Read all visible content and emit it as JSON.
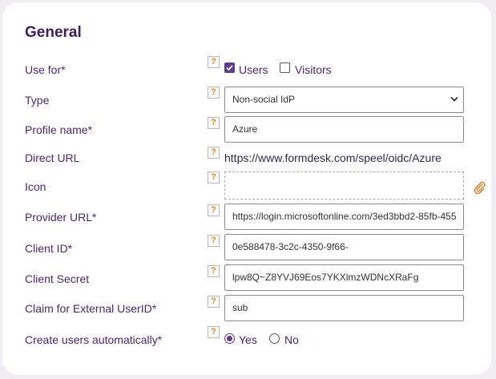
{
  "section": {
    "title": "General"
  },
  "help_glyph": "?",
  "colors": {
    "accent": "#5c3a91",
    "label": "#4a2773",
    "help": "#e08a1e"
  },
  "fields": {
    "use_for": {
      "label": "Use for*",
      "options": [
        {
          "label": "Users",
          "checked": true
        },
        {
          "label": "Visitors",
          "checked": false
        }
      ]
    },
    "type": {
      "label": "Type",
      "value": "Non-social IdP"
    },
    "profile_name": {
      "label": "Profile name*",
      "value": "Azure"
    },
    "direct_url": {
      "label": "Direct URL",
      "value": "https://www.formdesk.com/speel/oidc/Azure"
    },
    "icon": {
      "label": "Icon",
      "attach_icon": "paperclip-icon"
    },
    "provider_url": {
      "label": "Provider URL*",
      "value": "https://login.microsoftonline.com/3ed3bbd2-85fb-455"
    },
    "client_id": {
      "label": "Client ID*",
      "value": "0e588478-3c2c-4350-9f66-"
    },
    "client_secret": {
      "label": "Client Secret",
      "value": "lpw8Q~Z8YVJ69Eos7YKXlmzWDNcXRaFg"
    },
    "claim": {
      "label": "Claim for External UserID*",
      "value": "sub"
    },
    "create_users": {
      "label": "Create users automatically*",
      "options": [
        {
          "label": "Yes",
          "checked": true
        },
        {
          "label": "No",
          "checked": false
        }
      ]
    }
  }
}
